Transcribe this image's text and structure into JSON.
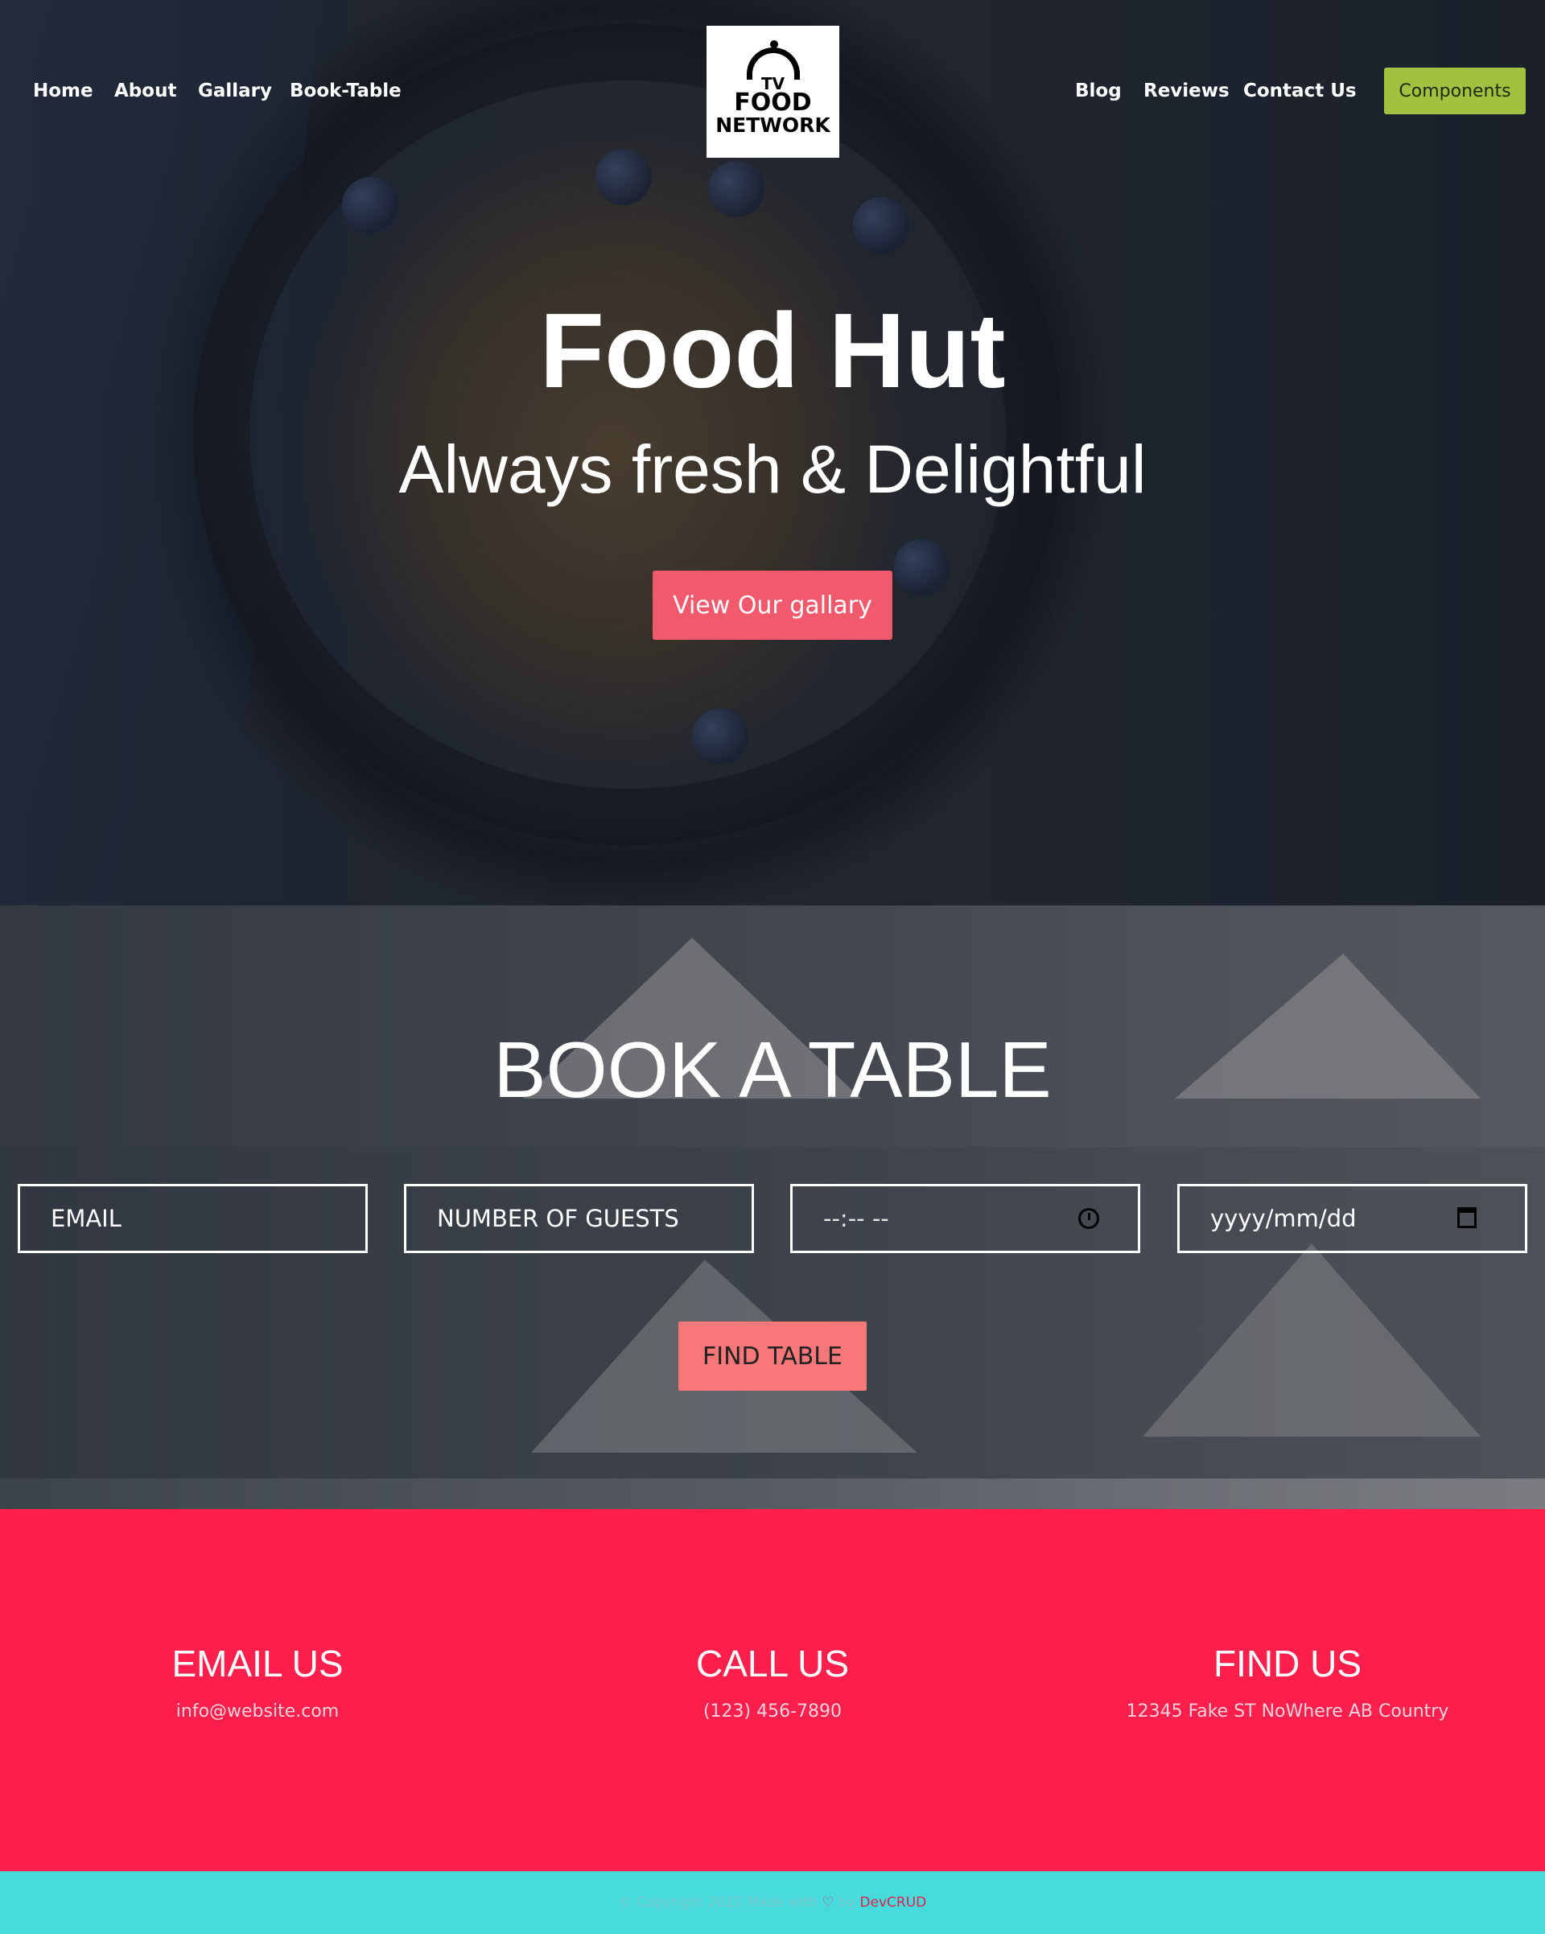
{
  "nav": {
    "left": [
      "Home",
      "About",
      "Gallary",
      "Book-Table"
    ],
    "right": [
      "Blog",
      "Reviews",
      "Contact Us"
    ],
    "components_label": "Components"
  },
  "logo": {
    "line1": "TV",
    "line2": "FOOD",
    "line3": "NETWORK"
  },
  "hero": {
    "title": "Food Hut",
    "subtitle": "Always fresh & Delightful",
    "button": "View Our gallary"
  },
  "booking": {
    "title": "BOOK A TABLE",
    "email_placeholder": "EMAIL",
    "guests_placeholder": "NUMBER OF GUESTS",
    "time_value": "--:-- --",
    "date_value": "yyyy/mm/dd",
    "button": "FIND TABLE"
  },
  "contact": [
    {
      "title": "EMAIL US",
      "value": "info@website.com"
    },
    {
      "title": "CALL US",
      "value": "(123) 456-7890"
    },
    {
      "title": "FIND US",
      "value": "12345 Fake ST NoWhere AB Country"
    }
  ],
  "footer": {
    "prefix": "© Copyright 2022 Made with",
    "by": "by",
    "brand": "DevCRUD"
  },
  "colors": {
    "accent_green": "#a2c140",
    "gallery_button": "#f15a6c",
    "find_button": "#f8787a",
    "contact_bg": "#fe1f4d",
    "footer_bg": "#48dbde"
  }
}
